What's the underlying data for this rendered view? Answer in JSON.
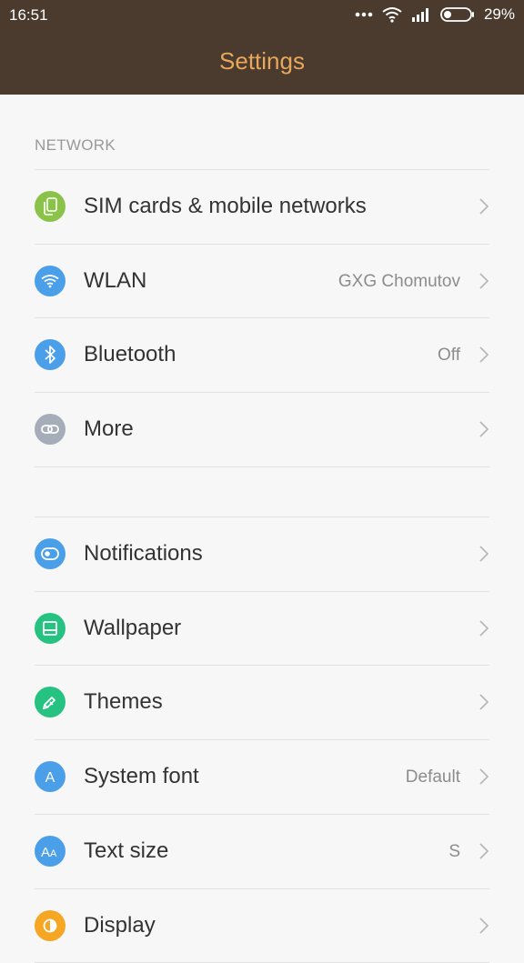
{
  "status_bar": {
    "time": "16:51",
    "battery_percent": "29%",
    "battery_level": 0.29,
    "icons": [
      "dots-icon",
      "wifi-icon",
      "signal-icon",
      "battery-icon"
    ]
  },
  "header": {
    "title": "Settings",
    "background_color": "#4a3b2e",
    "title_color": "#e8a75a"
  },
  "sections": {
    "network": {
      "label": "NETWORK",
      "items": [
        {
          "label": "SIM cards & mobile networks",
          "value": "",
          "icon": "sim-card-icon",
          "color": "#8bc34a"
        },
        {
          "label": "WLAN",
          "value": "GXG Chomutov",
          "icon": "wifi-icon",
          "color": "#4a9fe8"
        },
        {
          "label": "Bluetooth",
          "value": "Off",
          "icon": "bluetooth-icon",
          "color": "#4a9fe8"
        },
        {
          "label": "More",
          "value": "",
          "icon": "link-icon",
          "color": "#a5adb8"
        }
      ]
    },
    "personal": {
      "items": [
        {
          "label": "Notifications",
          "value": "",
          "icon": "toggle-icon",
          "color": "#4a9fe8"
        },
        {
          "label": "Wallpaper",
          "value": "",
          "icon": "wallpaper-icon",
          "color": "#26c281"
        },
        {
          "label": "Themes",
          "value": "",
          "icon": "brush-icon",
          "color": "#26c281"
        },
        {
          "label": "System font",
          "value": "Default",
          "icon": "font-icon",
          "color": "#4a9fe8"
        },
        {
          "label": "Text size",
          "value": "S",
          "icon": "text-size-icon",
          "color": "#4a9fe8"
        },
        {
          "label": "Display",
          "value": "",
          "icon": "display-icon",
          "color": "#f5a623"
        }
      ]
    }
  }
}
